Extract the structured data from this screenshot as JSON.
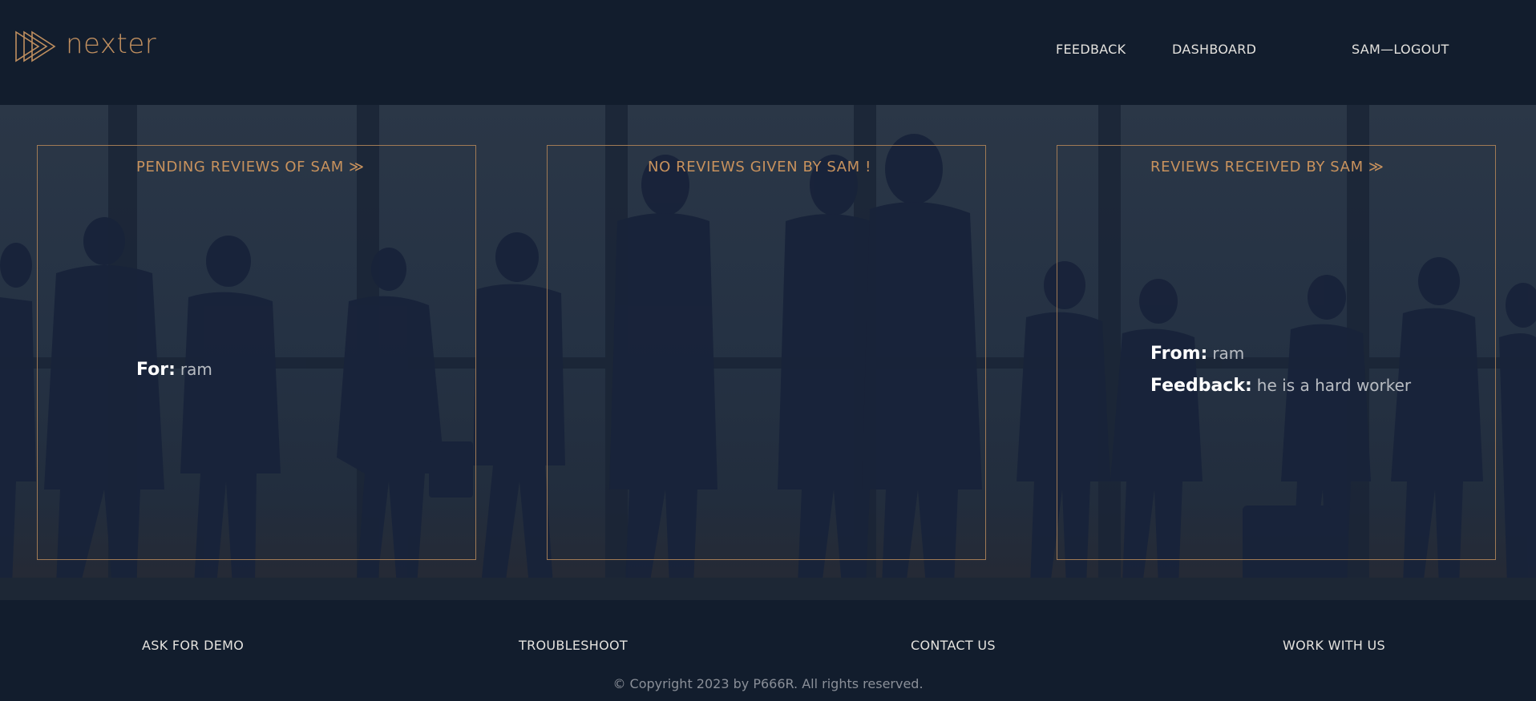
{
  "brand": {
    "name": "nexter",
    "logo_color": "#c08f5f"
  },
  "nav": {
    "feedback": "FEEDBACK",
    "dashboard": "DASHBOARD",
    "logout": "SAM—LOGOUT"
  },
  "cards": {
    "pending": {
      "title": "PENDING REVIEWS OF SAM ≫",
      "for_label": "For:",
      "for_value": "ram"
    },
    "given": {
      "title": "NO REVIEWS GIVEN BY SAM !"
    },
    "received": {
      "title": "REVIEWS RECEIVED BY SAM ≫",
      "from_label": "From:",
      "from_value": "ram",
      "feedback_label": "Feedback:",
      "feedback_value": "he is a hard worker"
    }
  },
  "footer": {
    "links": [
      "ASK FOR DEMO",
      "TROUBLESHOOT",
      "CONTACT US",
      "WORK WITH US"
    ],
    "copyright": "© Copyright 2023 by P666R. All rights reserved."
  },
  "colors": {
    "background": "#121d2d",
    "accent": "#c8925d",
    "card_border": "#a07a55",
    "text_light": "#e4e2de"
  }
}
